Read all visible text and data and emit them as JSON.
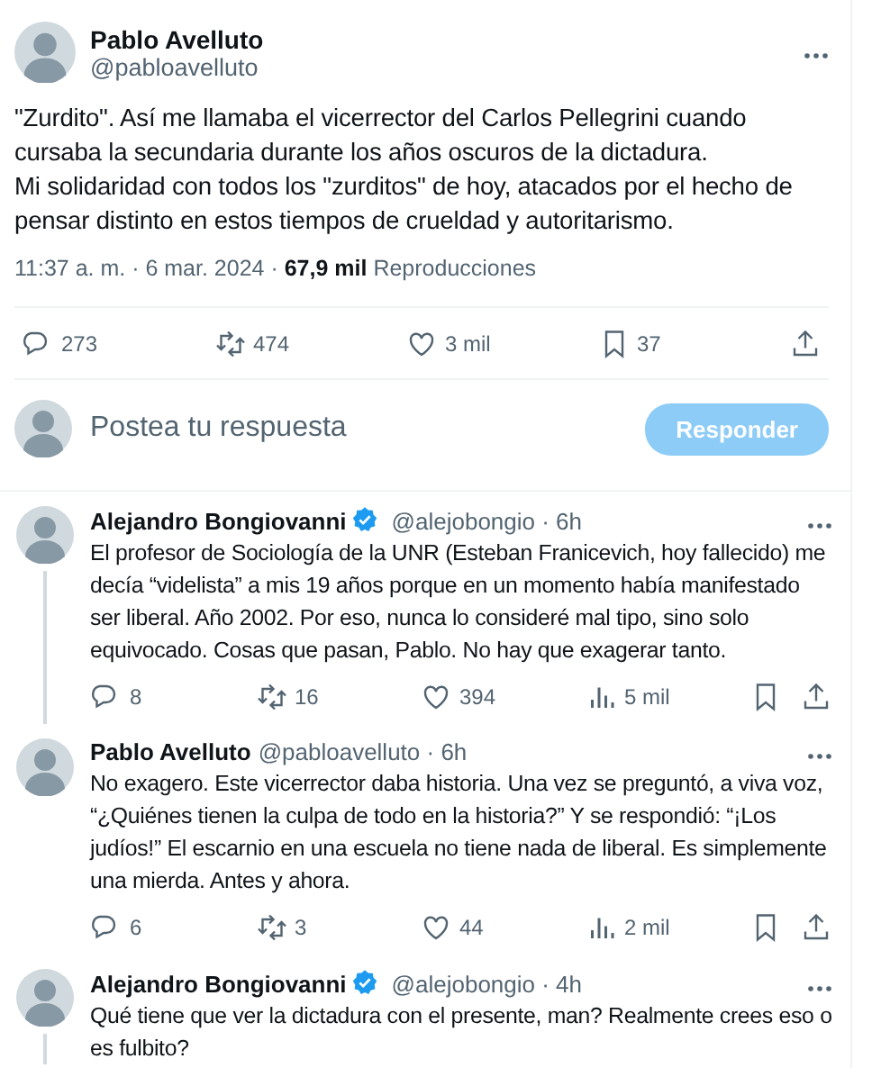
{
  "main_tweet": {
    "name": "Pablo Avelluto",
    "handle": "@pabloavelluto",
    "text": "\"Zurdito\". Así me llamaba el vicerrector del Carlos Pellegrini cuando cursaba la secundaria durante los años oscuros de la dictadura.\nMi solidaridad con todos los \"zurditos\" de hoy, atacados por el hecho de pensar distinto en estos tiempos de crueldad y autoritarismo.",
    "info": "11:37 a. m. · 6 mar. 2024 · **67,9 mil** Reproducciones",
    "actions": [
      {
        "kind": "reply",
        "count": "273"
      },
      {
        "kind": "repost",
        "count": "474"
      },
      {
        "kind": "like",
        "count": "3 mil"
      },
      {
        "kind": "bookmark",
        "count": "37"
      },
      {
        "kind": "share"
      }
    ]
  },
  "reply_box": {
    "placeholder": "Postea tu respuesta",
    "button": "Responder",
    "disabled": true
  },
  "replies": [
    {
      "name": "Alejandro Bongiovanni",
      "verified": true,
      "meta": "@alejobongio · 6h",
      "thread_line": true,
      "text": "El profesor de Sociología de la UNR (Esteban Franicevich, hoy fallecido) me decía “videlista” a mis 19 años porque en un momento había manifestado ser liberal. Año 2002. Por eso, nunca lo consideré mal tipo, sino solo equivocado. Cosas que pasan, Pablo. No hay que exagerar tanto.",
      "actions": [
        {
          "kind": "reply",
          "count": "8"
        },
        {
          "kind": "repost",
          "count": "16"
        },
        {
          "kind": "like",
          "count": "394"
        },
        {
          "kind": "views",
          "count": "5 mil"
        },
        {
          "kind": "bookmark"
        },
        {
          "kind": "share"
        }
      ]
    },
    {
      "name": "Pablo Avelluto",
      "verified": false,
      "meta": "@pabloavelluto · 6h",
      "thread_line": false,
      "text": "No exagero. Este vicerrector daba historia. Una vez se preguntó, a viva voz, “¿Quiénes tienen la culpa de todo en la historia?” Y se respondió: “¡Los judíos!” El escarnio en una escuela no tiene nada de liberal. Es simplemente una mierda. Antes y ahora.",
      "actions": [
        {
          "kind": "reply",
          "count": "6"
        },
        {
          "kind": "repost",
          "count": "3"
        },
        {
          "kind": "like",
          "count": "44"
        },
        {
          "kind": "views",
          "count": "2 mil"
        },
        {
          "kind": "bookmark"
        },
        {
          "kind": "share"
        }
      ]
    },
    {
      "name": "Alejandro Bongiovanni",
      "verified": true,
      "meta": "@alejobongio · 4h",
      "thread_line": true,
      "text": "Qué tiene que ver la dictadura con el presente, man? Realmente crees eso o es fulbito?"
    }
  ]
}
